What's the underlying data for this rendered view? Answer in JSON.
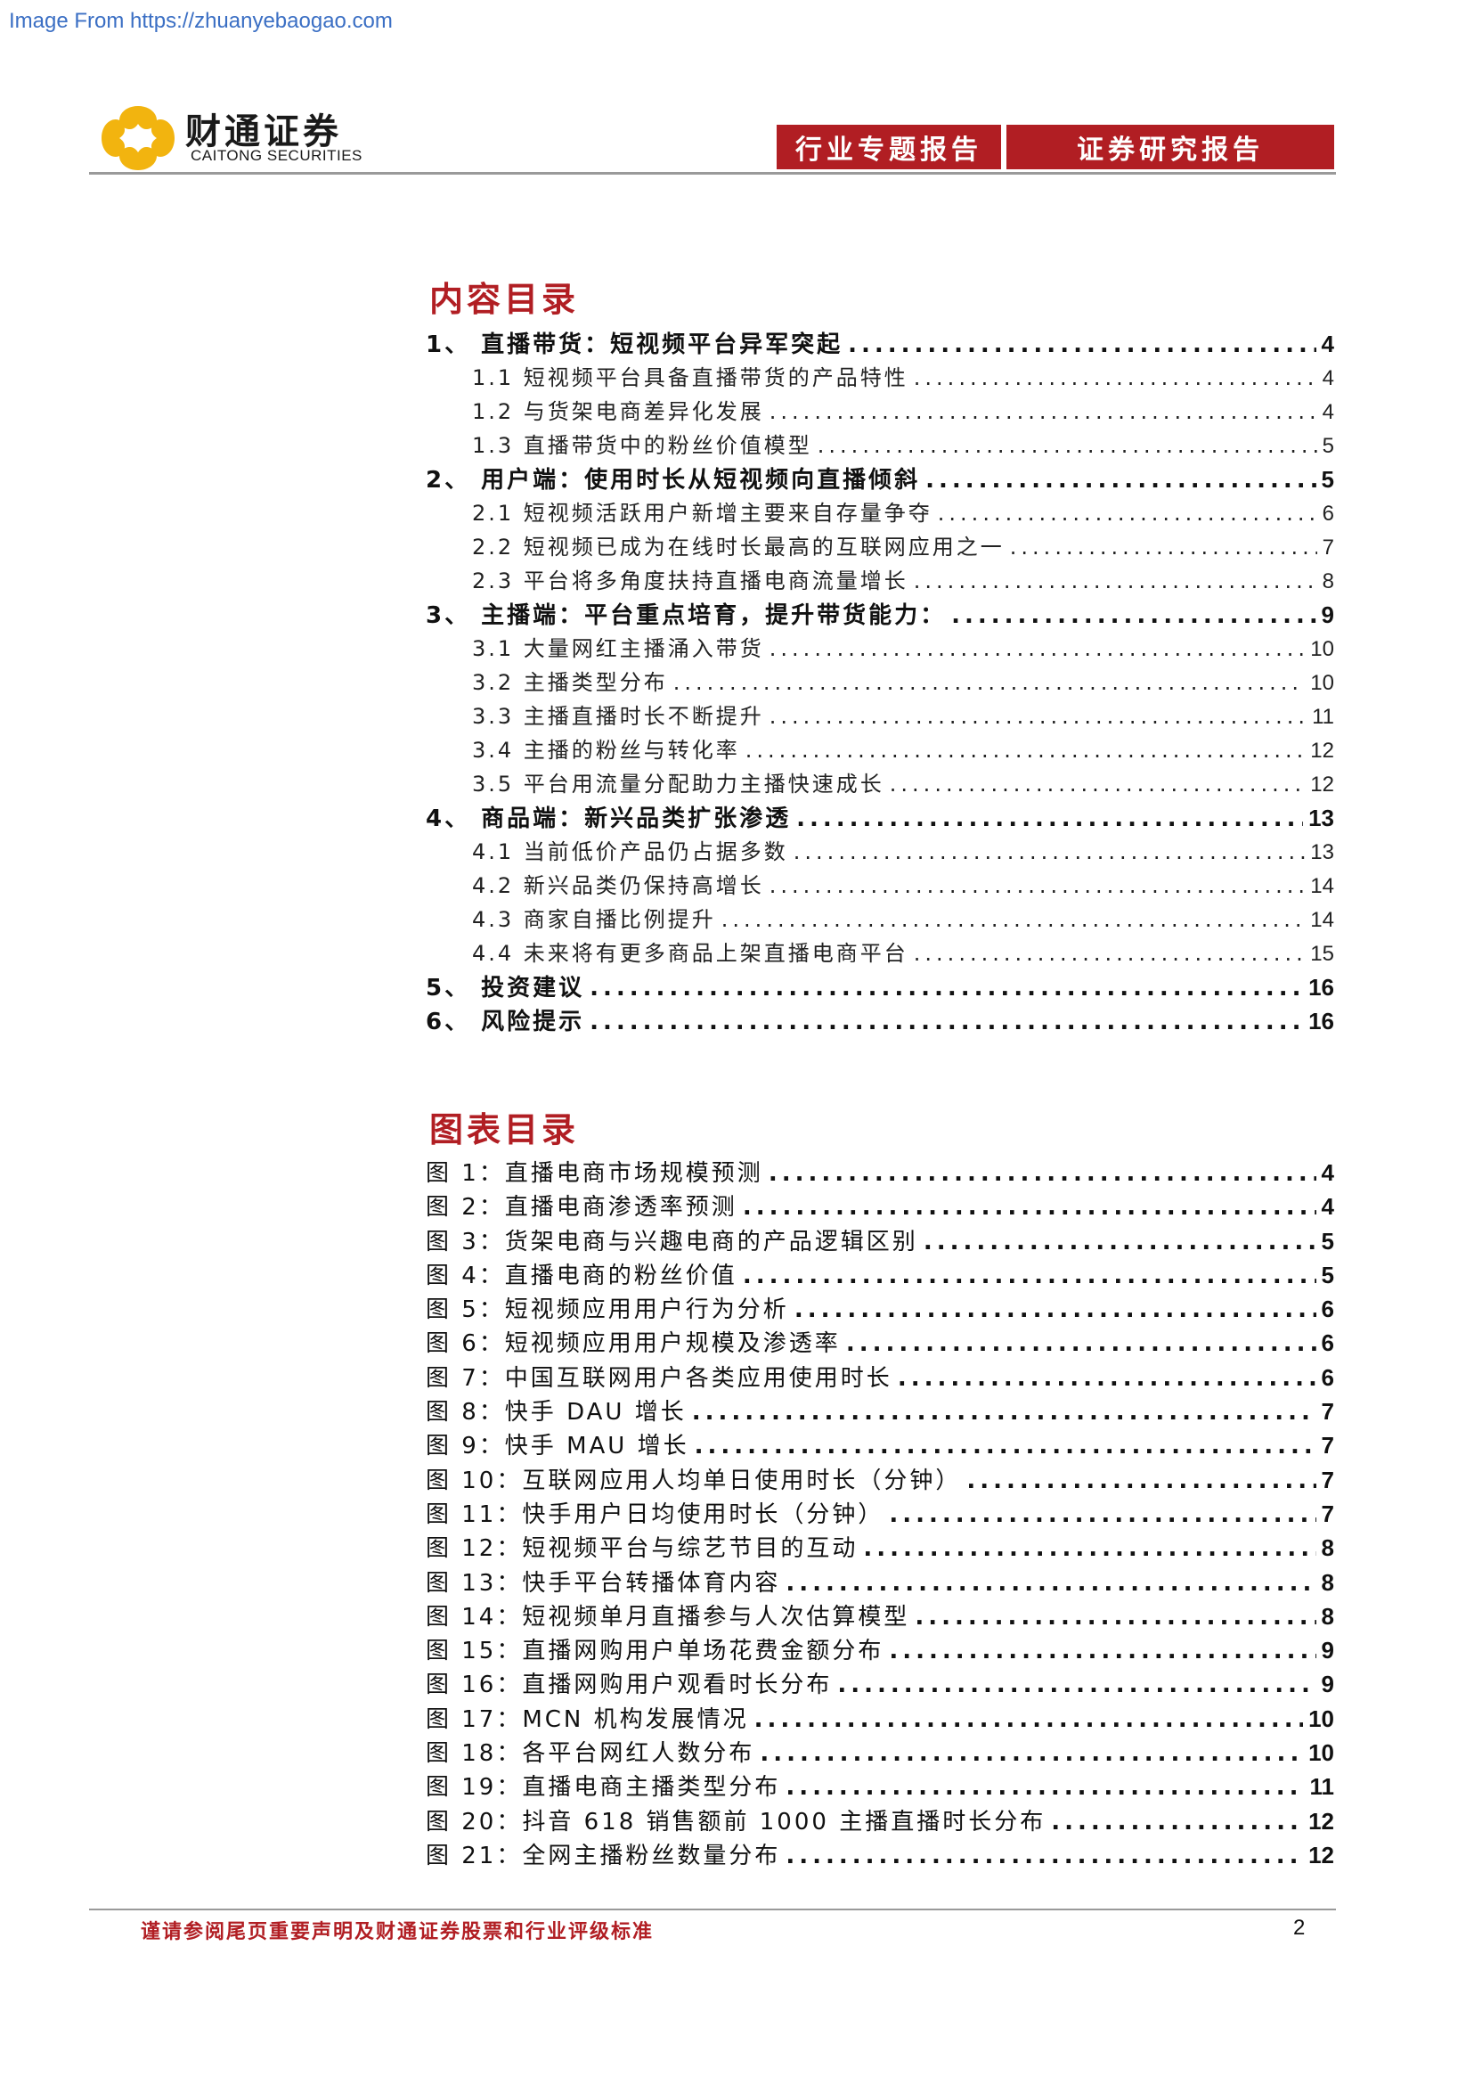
{
  "watermark": "Image From https://zhuanyebaogao.com",
  "logo": {
    "cn": "财通证券",
    "en": "CAITONG SECURITIES",
    "brand_color": "#f2b40f"
  },
  "header": {
    "tag1": "行业专题报告",
    "tag2": "证券研究报告",
    "accent": "#b11e23"
  },
  "toc": {
    "title": "内容目录",
    "items": [
      {
        "label": "1、  直播带货：短视频平台异军突起",
        "page": "4",
        "level": 1
      },
      {
        "label": "1.1  短视频平台具备直播带货的产品特性",
        "page": "4",
        "level": 2
      },
      {
        "label": "1.2  与货架电商差异化发展",
        "page": "4",
        "level": 2
      },
      {
        "label": "1.3  直播带货中的粉丝价值模型",
        "page": "5",
        "level": 2
      },
      {
        "label": "2、  用户端：使用时长从短视频向直播倾斜",
        "page": "5",
        "level": 1
      },
      {
        "label": "2.1  短视频活跃用户新增主要来自存量争夺",
        "page": "6",
        "level": 2
      },
      {
        "label": "2.2  短视频已成为在线时长最高的互联网应用之一",
        "page": "7",
        "level": 2
      },
      {
        "label": "2.3  平台将多角度扶持直播电商流量增长",
        "page": "8",
        "level": 2
      },
      {
        "label": "3、  主播端：平台重点培育，提升带货能力：",
        "page": "9",
        "level": 1
      },
      {
        "label": "3.1  大量网红主播涌入带货",
        "page": "10",
        "level": 2
      },
      {
        "label": "3.2  主播类型分布",
        "page": "10",
        "level": 2
      },
      {
        "label": "3.3  主播直播时长不断提升",
        "page": "11",
        "level": 2
      },
      {
        "label": "3.4  主播的粉丝与转化率",
        "page": "12",
        "level": 2
      },
      {
        "label": "3.5  平台用流量分配助力主播快速成长",
        "page": "12",
        "level": 2
      },
      {
        "label": "4、  商品端：新兴品类扩张渗透",
        "page": "13",
        "level": 1
      },
      {
        "label": "4.1  当前低价产品仍占据多数",
        "page": "13",
        "level": 2
      },
      {
        "label": "4.2  新兴品类仍保持高增长",
        "page": "14",
        "level": 2
      },
      {
        "label": "4.3  商家自播比例提升",
        "page": "14",
        "level": 2
      },
      {
        "label": "4.4  未来将有更多商品上架直播电商平台",
        "page": "15",
        "level": 2
      },
      {
        "label": "5、  投资建议",
        "page": "16",
        "level": 1
      },
      {
        "label": "6、  风险提示",
        "page": "16",
        "level": 1
      }
    ]
  },
  "figures": {
    "title": "图表目录",
    "items": [
      {
        "label": "图 1：直播电商市场规模预测",
        "page": "4"
      },
      {
        "label": "图 2：直播电商渗透率预测",
        "page": "4"
      },
      {
        "label": "图 3：货架电商与兴趣电商的产品逻辑区别",
        "page": "5"
      },
      {
        "label": "图 4：直播电商的粉丝价值",
        "page": "5"
      },
      {
        "label": "图 5：短视频应用用户行为分析",
        "page": "6"
      },
      {
        "label": "图 6：短视频应用用户规模及渗透率",
        "page": "6"
      },
      {
        "label": "图 7：中国互联网用户各类应用使用时长",
        "page": "6"
      },
      {
        "label": "图 8：快手 DAU 增长",
        "page": "7"
      },
      {
        "label": "图 9：快手 MAU 增长",
        "page": "7"
      },
      {
        "label": "图 10：互联网应用人均单日使用时长（分钟）",
        "page": "7"
      },
      {
        "label": "图 11：快手用户日均使用时长（分钟）",
        "page": "7"
      },
      {
        "label": "图 12：短视频平台与综艺节目的互动",
        "page": "8"
      },
      {
        "label": "图 13：快手平台转播体育内容",
        "page": "8"
      },
      {
        "label": "图 14：短视频单月直播参与人次估算模型",
        "page": "8"
      },
      {
        "label": "图 15：直播网购用户单场花费金额分布",
        "page": "9"
      },
      {
        "label": "图 16：直播网购用户观看时长分布",
        "page": "9"
      },
      {
        "label": "图 17：MCN 机构发展情况",
        "page": "10"
      },
      {
        "label": "图 18：各平台网红人数分布",
        "page": "10"
      },
      {
        "label": "图 19：直播电商主播类型分布",
        "page": "11"
      },
      {
        "label": "图 20：抖音 618 销售额前 1000 主播直播时长分布",
        "page": "12"
      },
      {
        "label": "图 21：全网主播粉丝数量分布",
        "page": "12"
      }
    ]
  },
  "footer": {
    "disclaimer": "谨请参阅尾页重要声明及财通证券股票和行业评级标准",
    "page_number": "2"
  }
}
